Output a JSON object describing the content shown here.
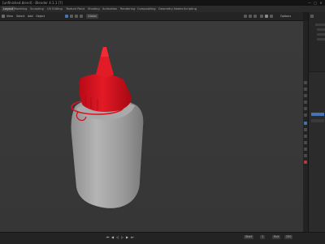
{
  "window": {
    "title": "[unfinished.blend] - Blender 4.1.1 [?]",
    "controls": [
      "—",
      "□",
      "✕"
    ]
  },
  "workspaces": [
    "Layout",
    "Modeling",
    "Sculpting",
    "UV Editing",
    "Texture Paint",
    "Shading",
    "Animation",
    "Rendering",
    "Compositing",
    "Geometry Nodes",
    "Scripting"
  ],
  "viewport_header": {
    "view": "View",
    "select": "Select",
    "add": "Add",
    "object": "Object",
    "orientation": "Global",
    "options": "Options"
  },
  "timeline": {
    "start_label": "Start",
    "start": "1",
    "end_label": "End",
    "end": "250"
  },
  "colors": {
    "accent": "#4772b3",
    "cap": "#d8101d",
    "bottle": "#9a9a9a"
  }
}
